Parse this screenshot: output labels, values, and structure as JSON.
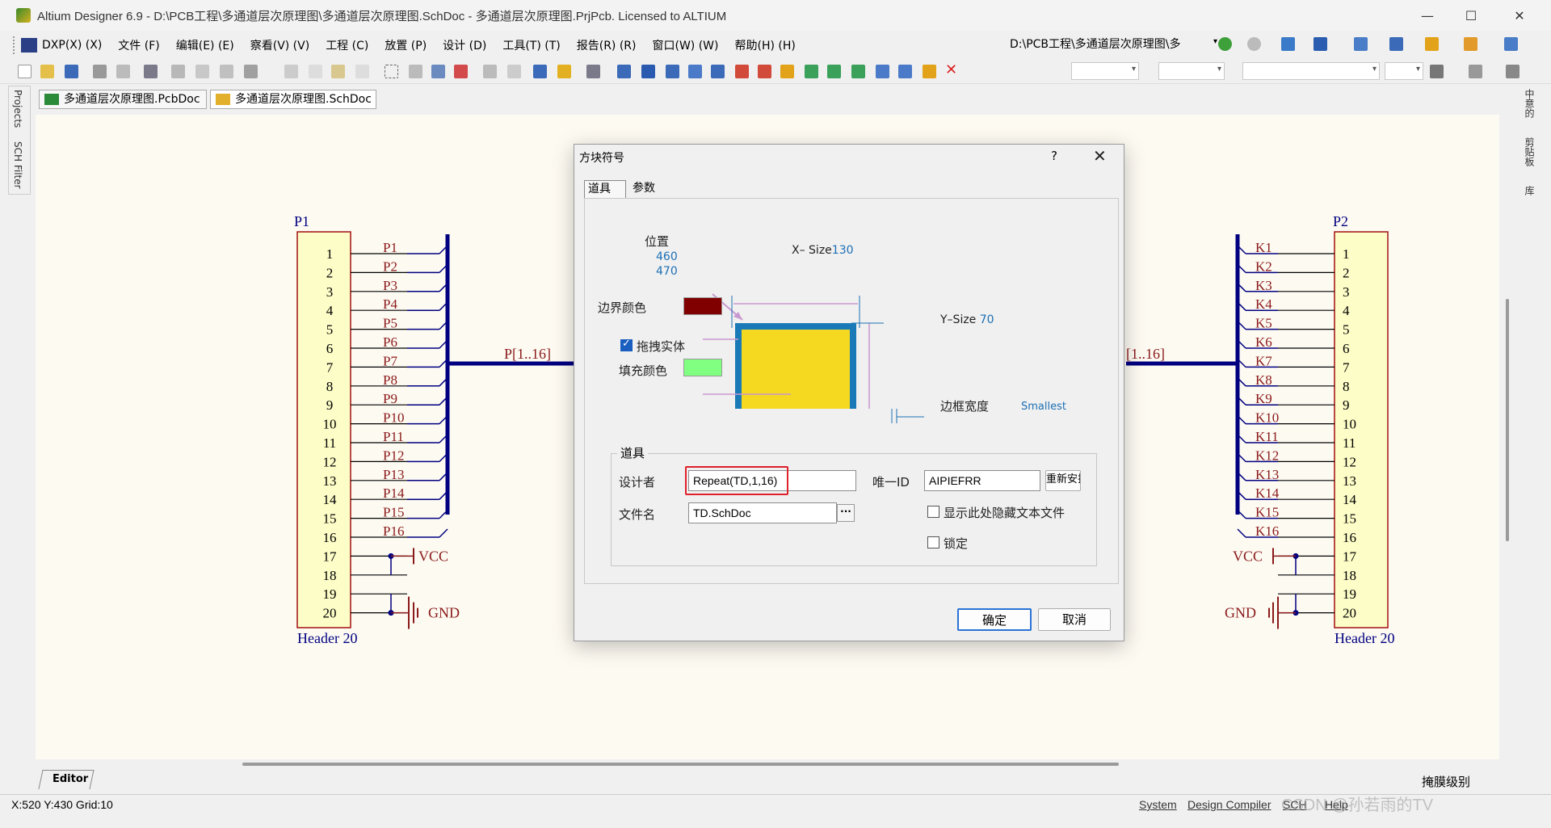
{
  "window": {
    "title": "Altium Designer 6.9 - D:\\PCB工程\\多通道层次原理图\\多通道层次原理图.SchDoc - 多通道层次原理图.PrjPcb. Licensed to ALTIUM",
    "minimize": "—",
    "maximize": "☐",
    "close": "✕"
  },
  "menu": {
    "items": [
      "DXP(X) (X)",
      "文件 (F)",
      "编辑(E) (E)",
      "察看(V) (V)",
      "工程 (C)",
      "放置 (P)",
      "设计 (D)",
      "工具(T) (T)",
      "报告(R) (R)",
      "窗口(W) (W)",
      "帮助(H) (H)"
    ],
    "path": "D:\\PCB工程\\多通道层次原理图\\多"
  },
  "doc_tabs": [
    "多通道层次原理图.PcbDoc",
    "多通道层次原理图.SchDoc"
  ],
  "side_panels": {
    "left": [
      "Projects",
      "SCH Filter"
    ],
    "right": [
      "中意的",
      "剪贴板",
      "库"
    ]
  },
  "schematic": {
    "left_header": {
      "designator": "P1",
      "comment": "Header 20",
      "pins": [
        "1",
        "2",
        "3",
        "4",
        "5",
        "6",
        "7",
        "8",
        "9",
        "10",
        "11",
        "12",
        "13",
        "14",
        "15",
        "16",
        "17",
        "18",
        "19",
        "20"
      ],
      "nets": [
        "P1",
        "P2",
        "P3",
        "P4",
        "P5",
        "P6",
        "P7",
        "P8",
        "P9",
        "P10",
        "P11",
        "P12",
        "P13",
        "P14",
        "P15",
        "P16"
      ],
      "bus_label": "P[1..16]"
    },
    "right_header": {
      "designator": "P2",
      "comment": "Header 20",
      "pins": [
        "1",
        "2",
        "3",
        "4",
        "5",
        "6",
        "7",
        "8",
        "9",
        "10",
        "11",
        "12",
        "13",
        "14",
        "15",
        "16",
        "17",
        "18",
        "19",
        "20"
      ],
      "nets": [
        "K1",
        "K2",
        "K3",
        "K4",
        "K5",
        "K6",
        "K7",
        "K8",
        "K9",
        "K10",
        "K11",
        "K12",
        "K13",
        "K14",
        "K15",
        "K16"
      ],
      "bus_label": "[1..16]"
    },
    "vcc": "VCC",
    "gnd": "GND"
  },
  "dialog": {
    "title": "方块符号",
    "help": "?",
    "close": "✕",
    "tabs": [
      "道具",
      "参数"
    ],
    "preview": {
      "position_label": "位置",
      "pos_x": "460",
      "pos_y": "470",
      "xsize_label": "X– Size",
      "xsize_value": "130",
      "ysize_label": "Y–Size",
      "ysize_value": "70",
      "border_color_label": "边界颜色",
      "border_color": "#800000",
      "draw_solid_label": "拖拽实体",
      "draw_solid_checked": true,
      "fill_color_label": "填充颜色",
      "fill_color": "#80ff80",
      "border_width_label": "边框宽度",
      "border_width_value": "Smallest"
    },
    "group_title": "道具",
    "designator_label": "设计者",
    "designator_value": "Repeat(TD,1,16)",
    "unique_id_label": "唯一ID",
    "unique_id_value": "AIPIEFRR",
    "reset_button": "重新安排",
    "filename_label": "文件名",
    "filename_value": "TD.SchDoc",
    "browse_button": "···",
    "show_hidden_label": "显示此处隐藏文本文件",
    "show_hidden_checked": false,
    "lock_label": "锁定",
    "lock_checked": false,
    "ok_button": "确定",
    "cancel_button": "取消"
  },
  "editor_tab": "Editor",
  "status": {
    "coords": "X:520 Y:430   Grid:10",
    "buttons": [
      "System",
      "Design Compiler",
      "SCH",
      "Help"
    ],
    "mask_level": "掩膜级别",
    "watermark": "CSDN @孙若雨的TV"
  }
}
